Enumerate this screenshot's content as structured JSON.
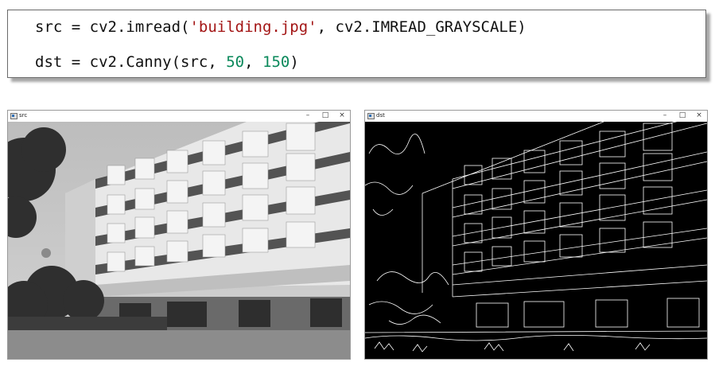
{
  "code": {
    "line1": {
      "pre": "src = cv2.imread(",
      "str": "'building.jpg'",
      "post": ", cv2.IMREAD_GRAYSCALE)"
    },
    "line2": {
      "pre": "dst = cv2.Canny(src, ",
      "num1": "50",
      "sep": ", ",
      "num2": "150",
      "post": ")"
    }
  },
  "windows": {
    "src": {
      "title": "src",
      "min": "–",
      "max": "□",
      "close": "×"
    },
    "dst": {
      "title": "dst",
      "min": "–",
      "max": "□",
      "close": "×"
    }
  }
}
